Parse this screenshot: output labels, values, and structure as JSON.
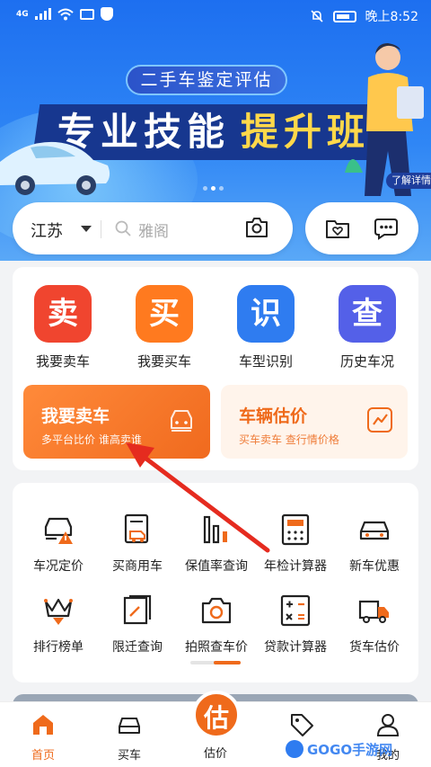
{
  "status_bar": {
    "network": "4G",
    "time": "晚上8:52"
  },
  "banner": {
    "pill_text": "二手车鉴定评估",
    "title_white": "专业技能",
    "title_yellow": "提升班",
    "more_label": "了解详情",
    "slide_index": 1,
    "slide_count": 3
  },
  "search": {
    "city": "江苏",
    "placeholder": "雅阁"
  },
  "quick_entries": [
    {
      "label": "我要卖车",
      "glyph": "卖",
      "color": "#f0452f"
    },
    {
      "label": "我要买车",
      "glyph": "买",
      "color": "#ff7a1f"
    },
    {
      "label": "车型识别",
      "glyph": "识",
      "color": "#2f7cf0"
    },
    {
      "label": "历史车况",
      "glyph": "查",
      "color": "#5460e8"
    }
  ],
  "promo_sell": {
    "title": "我要卖车",
    "subtitle": "多平台比价 谁高卖谁"
  },
  "promo_value": {
    "title": "车辆估价",
    "subtitle": "买车卖车 查行情价格"
  },
  "tools": [
    {
      "label": "车况定价",
      "icon": "car-warning-icon"
    },
    {
      "label": "买商用车",
      "icon": "truck-doc-icon"
    },
    {
      "label": "保值率查询",
      "icon": "bar-chart-icon"
    },
    {
      "label": "年检计算器",
      "icon": "calculator-icon"
    },
    {
      "label": "新车优惠",
      "icon": "car-icon"
    },
    {
      "label": "排行榜单",
      "icon": "crown-icon"
    },
    {
      "label": "限迁查询",
      "icon": "document-icon"
    },
    {
      "label": "拍照查车价",
      "icon": "camera-icon"
    },
    {
      "label": "贷款计算器",
      "icon": "calculator-icon"
    },
    {
      "label": "货车估价",
      "icon": "truck-icon"
    }
  ],
  "tabbar": {
    "home": "首页",
    "buy": "买车",
    "valuation": "估价",
    "valuation_glyph": "估",
    "news": "",
    "mine": "我的"
  },
  "watermark": "GOGO手游网",
  "accent_color": "#ef6a1b"
}
